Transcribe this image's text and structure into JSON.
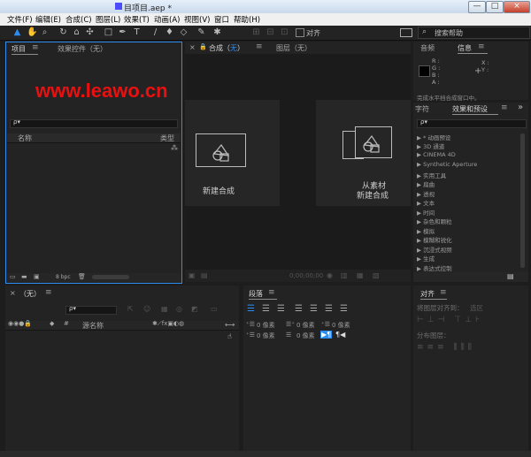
{
  "window": {
    "title": "未命名项目.aep *",
    "title_visible": "目项目.aep *",
    "min": "—",
    "max": "□",
    "close": "×"
  },
  "menu": [
    "文件(F)",
    "编辑(E)",
    "合成(C)",
    "图层(L)",
    "效果(T)",
    "动画(A)",
    "视图(V)",
    "窗口",
    "帮助(H)"
  ],
  "toolbar": {
    "align_label": "对齐",
    "search_help_label": "搜索帮助"
  },
  "project": {
    "tab_project": "项目",
    "tab_effect_controls": "效果控件（无）",
    "col_name": "名称",
    "col_type": "类型",
    "bpc": "8 bpc",
    "watermark": "www.leawo.cn",
    "search_icon_text": "ρ▾"
  },
  "composition": {
    "tab_comp_prefix": "合成（",
    "tab_comp_none": "无",
    "tab_comp_suffix": "）",
    "tab_layer": "图层（无）",
    "new_comp": "新建合成",
    "from_footage_1": "从素材",
    "from_footage_2": "新建合成",
    "timecode": "0;00;00;00"
  },
  "audio_info": {
    "tab_audio": "音频",
    "tab_info": "信息",
    "r": "R :",
    "g": "G :",
    "b": "B :",
    "a": "A :",
    "x": "X :",
    "y": "Y :",
    "message": "完成水平挡合成窗口中。"
  },
  "effects": {
    "tab_char": "字符",
    "tab_effects": "效果和预设",
    "more": "»",
    "items": [
      "▶ * 动画预设",
      "▶ 3D 通道",
      "▶ CINEMA 4D",
      "▶ Synthetic Aperture",
      "▶ 实用工具",
      "▶ 扁曲",
      "▶ 透视",
      "▶ 文本",
      "▶ 时间",
      "▶ 杂色和颗粒",
      "▶ 模拟",
      "▶ 模糊和锐化",
      "▶ 沉浸式视频",
      "▶ 生成",
      "▶ 表达式控制"
    ]
  },
  "timeline": {
    "tab": "（无）",
    "col_source": "源名称",
    "search_icon_text": "ρ▾"
  },
  "paragraph": {
    "tab": "段落",
    "px": "0 像素"
  },
  "align": {
    "tab": "对齐",
    "align_to": "将图层对齐到：",
    "align_to_value": "选区",
    "distribute": "分布图层："
  }
}
